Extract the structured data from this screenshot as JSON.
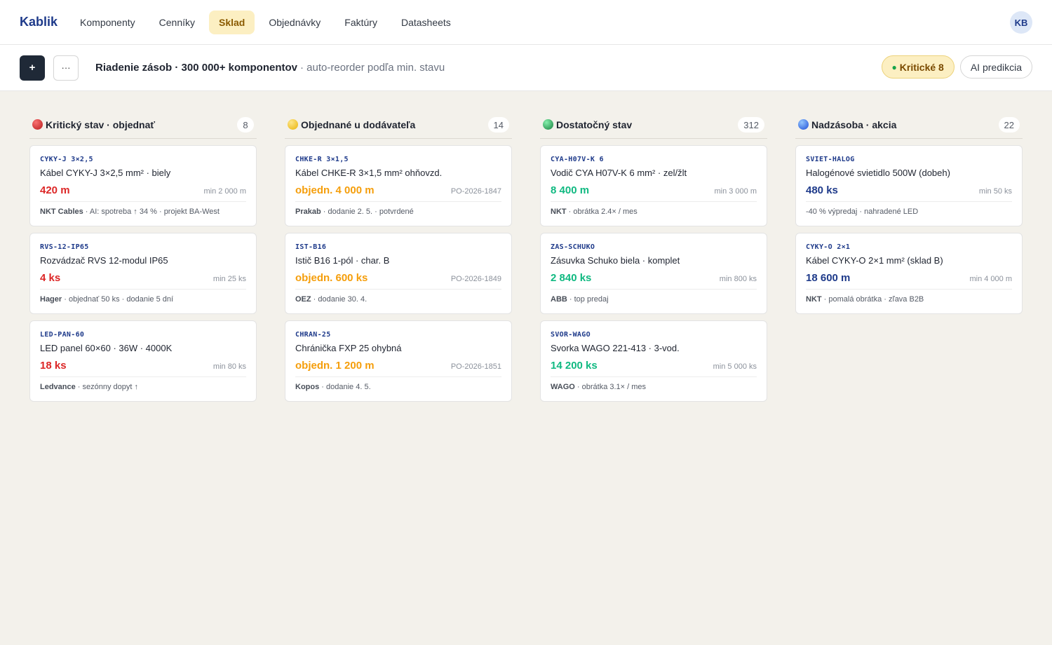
{
  "nav": {
    "logo": "Kablik",
    "items": [
      {
        "label": "Komponenty",
        "active": false
      },
      {
        "label": "Cenníky",
        "active": false
      },
      {
        "label": "Sklad",
        "active": true
      },
      {
        "label": "Objednávky",
        "active": false
      },
      {
        "label": "Faktúry",
        "active": false
      },
      {
        "label": "Datasheets",
        "active": false
      }
    ],
    "avatar": "KB"
  },
  "toolbar": {
    "add_label": "+",
    "more_label": "···",
    "title": "Riadenie zásob · 300 000+ komponentov",
    "subtitle": "· auto-reorder podľa min. stavu",
    "critical_dot": "●",
    "critical_label": "Kritické 8",
    "ai_label": "AI predikcia"
  },
  "columns": [
    {
      "title": "Kritický stav · objednať",
      "count": "8",
      "color": "#dc2626",
      "cards": [
        {
          "code": "CYKY-J 3×2,5",
          "name": "Kábel CYKY-J 3×2,5 mm² · biely",
          "qty": "420 m",
          "min": "min 2 000 m",
          "vendor": "NKT Cables",
          "meta": " · AI: spotreba ↑ 34 % · projekt BA-West"
        },
        {
          "code": "RVS-12-IP65",
          "name": "Rozvádzač RVS 12-modul IP65",
          "qty": "4 ks",
          "min": "min 25 ks",
          "vendor": "Hager",
          "meta": " · objednať 50 ks · dodanie 5 dní"
        },
        {
          "code": "LED-PAN-60",
          "name": "LED panel 60×60 · 36W · 4000K",
          "qty": "18 ks",
          "min": "min 80 ks",
          "vendor": "Ledvance",
          "meta": " · sezónny dopyt ↑"
        }
      ]
    },
    {
      "title": "Objednané u dodávateľa",
      "count": "14",
      "color": "#facc15",
      "cards": [
        {
          "code": "CHKE-R 3×1,5",
          "name": "Kábel CHKE-R 3×1,5 mm² ohňovzd.",
          "qty": "objedn. 4 000 m",
          "min": "PO-2026-1847",
          "vendor": "Prakab",
          "meta": " · dodanie 2. 5. · potvrdené"
        },
        {
          "code": "IST-B16",
          "name": "Istič B16 1-pól · char. B",
          "qty": "objedn. 600 ks",
          "min": "PO-2026-1849",
          "vendor": "OEZ",
          "meta": " · dodanie 30. 4."
        },
        {
          "code": "CHRAN-25",
          "name": "Chránička FXP 25 ohybná",
          "qty": "objedn. 1 200 m",
          "min": "PO-2026-1851",
          "vendor": "Kopos",
          "meta": " · dodanie 4. 5."
        }
      ]
    },
    {
      "title": "Dostatočný stav",
      "count": "312",
      "color": "#16a34a",
      "cards": [
        {
          "code": "CYA-H07V-K 6",
          "name": "Vodič CYA H07V-K 6 mm² · zel/žlt",
          "qty": "8 400 m",
          "min": "min 3 000 m",
          "vendor": "NKT",
          "meta": " · obrátka 2.4× / mes"
        },
        {
          "code": "ZAS-SCHUKO",
          "name": "Zásuvka Schuko biela · komplet",
          "qty": "2 840 ks",
          "min": "min 800 ks",
          "vendor": "ABB",
          "meta": " · top predaj"
        },
        {
          "code": "SVOR-WAGO",
          "name": "Svorka WAGO 221-413 · 3-vod.",
          "qty": "14 200 ks",
          "min": "min 5 000 ks",
          "vendor": "WAGO",
          "meta": " · obrátka 3.1× / mes"
        }
      ]
    },
    {
      "title": "Nadzásoba · akcia",
      "count": "22",
      "color": "#2563eb",
      "cards": [
        {
          "code": "SVIET-HALOG",
          "name": "Halogénové svietidlo 500W (dobeh)",
          "qty": "480 ks",
          "min": "min 50 ks",
          "vendor": "",
          "meta": "-40 % výpredaj · nahradené LED"
        },
        {
          "code": "CYKY-O 2×1",
          "name": "Kábel CYKY-O 2×1 mm² (sklad B)",
          "qty": "18 600 m",
          "min": "min 4 000 m",
          "vendor": "NKT",
          "meta": " · pomalá obrátka · zľava B2B"
        }
      ]
    }
  ]
}
